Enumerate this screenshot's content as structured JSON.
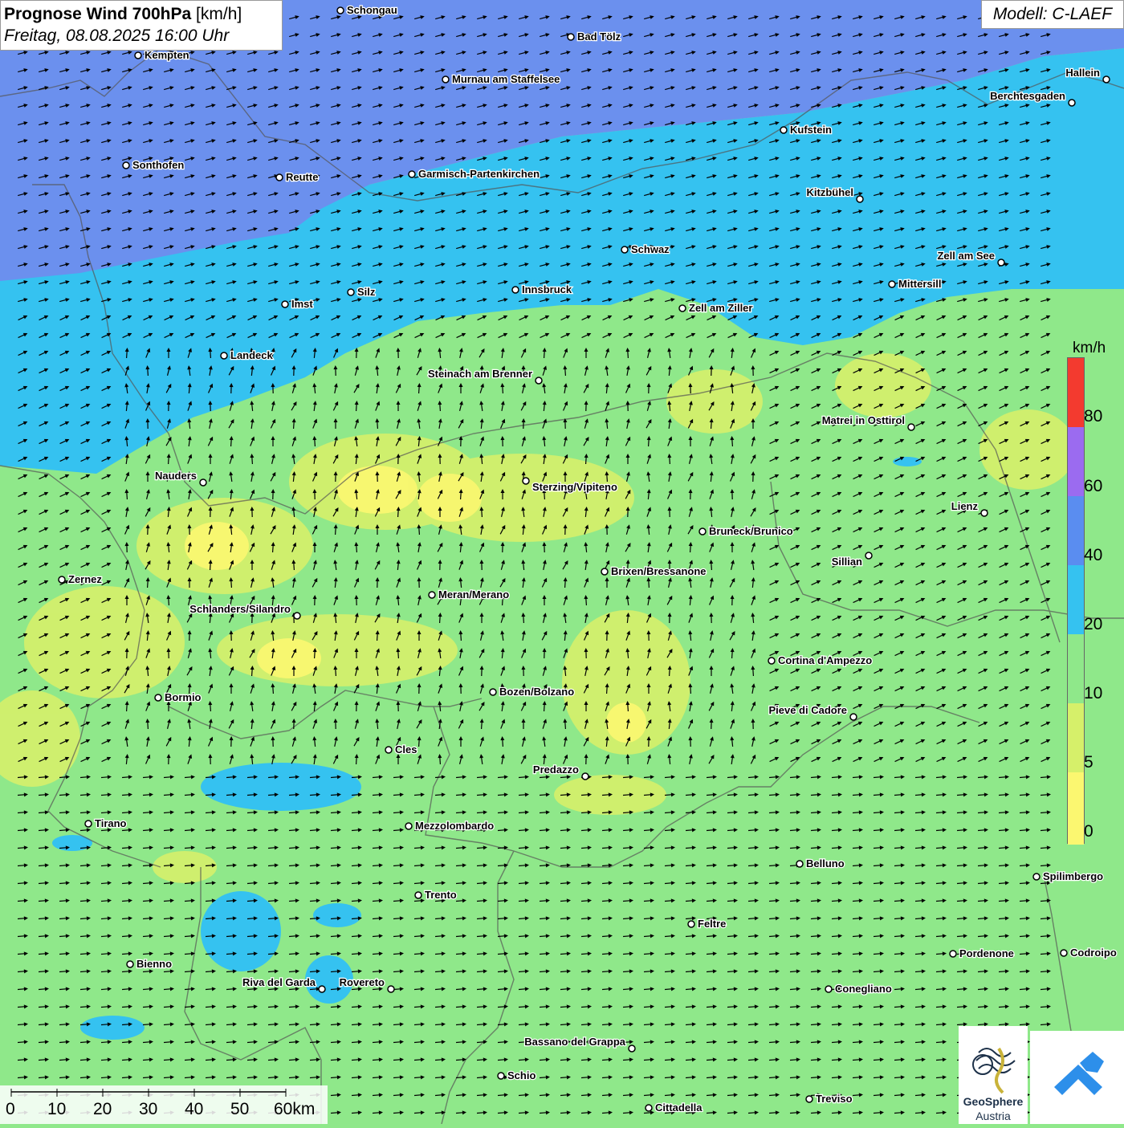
{
  "title": {
    "main": "Prognose Wind 700hPa",
    "unit": "[km/h]",
    "date": "Freitag, 08.08.2025 16:00 Uhr"
  },
  "model": "Modell: C-LAEF",
  "legend": {
    "unit": "km/h",
    "labels": [
      "80",
      "60",
      "40",
      "20",
      "10",
      "5",
      "0"
    ],
    "colors": [
      "#f33a2f",
      "#9b6bf0",
      "#5a8df0",
      "#35c2f0",
      "#8fe88a",
      "#d6f06a",
      "#fbf770"
    ]
  },
  "scalebar": {
    "labels": [
      "0",
      "10",
      "20",
      "30",
      "40",
      "50",
      "60km"
    ]
  },
  "logo": {
    "line1": "GeoSphere",
    "line2": "Austria"
  },
  "cities": [
    {
      "name": "Schongau",
      "anchor": "right"
    },
    {
      "name": "Bad Tölz",
      "anchor": "right"
    },
    {
      "name": "Kempten",
      "anchor": "right"
    },
    {
      "name": "Murnau am Staffelsee",
      "anchor": "right"
    },
    {
      "name": "Hallein",
      "anchor": "left"
    },
    {
      "name": "Berchtesgaden",
      "anchor": "left"
    },
    {
      "name": "Kufstein",
      "anchor": "right"
    },
    {
      "name": "Sonthofen",
      "anchor": "right"
    },
    {
      "name": "Reutte",
      "anchor": "right"
    },
    {
      "name": "Garmisch-Partenkirchen",
      "anchor": "right"
    },
    {
      "name": "Kitzbühel",
      "anchor": "left"
    },
    {
      "name": "Schwaz",
      "anchor": "right"
    },
    {
      "name": "Zell am See",
      "anchor": "left"
    },
    {
      "name": "Mittersill",
      "anchor": "right"
    },
    {
      "name": "Imst",
      "anchor": "right"
    },
    {
      "name": "Silz",
      "anchor": "right"
    },
    {
      "name": "Innsbruck",
      "anchor": "right"
    },
    {
      "name": "Zell am Ziller",
      "anchor": "right"
    },
    {
      "name": "Landeck",
      "anchor": "right"
    },
    {
      "name": "Steinach am Brenner",
      "anchor": "left"
    },
    {
      "name": "Matrei in Osttirol",
      "anchor": "left"
    },
    {
      "name": "Nauders",
      "anchor": "left"
    },
    {
      "name": "Sterzing/Vipiteno",
      "anchor": "rightbelow"
    },
    {
      "name": "Lienz",
      "anchor": "left"
    },
    {
      "name": "Bruneck/Brunico",
      "anchor": "right"
    },
    {
      "name": "Sillian",
      "anchor": "leftbelow"
    },
    {
      "name": "Zernez",
      "anchor": "right"
    },
    {
      "name": "Brixen/Bressanone",
      "anchor": "right"
    },
    {
      "name": "Meran/Merano",
      "anchor": "right"
    },
    {
      "name": "Schlanders/Silandro",
      "anchor": "leftabove"
    },
    {
      "name": "Cortina d'Ampezzo",
      "anchor": "right"
    },
    {
      "name": "Bozen/Bolzano",
      "anchor": "right"
    },
    {
      "name": "Bormio",
      "anchor": "right"
    },
    {
      "name": "Pieve di Cadore",
      "anchor": "leftabove"
    },
    {
      "name": "Cles",
      "anchor": "right"
    },
    {
      "name": "Predazzo",
      "anchor": "leftabove"
    },
    {
      "name": "Tirano",
      "anchor": "right"
    },
    {
      "name": "Mezzolombardo",
      "anchor": "right"
    },
    {
      "name": "Belluno",
      "anchor": "right"
    },
    {
      "name": "Spilimbergo",
      "anchor": "right"
    },
    {
      "name": "Trento",
      "anchor": "right"
    },
    {
      "name": "Feltre",
      "anchor": "right"
    },
    {
      "name": "Pordenone",
      "anchor": "right"
    },
    {
      "name": "Codroipo",
      "anchor": "right"
    },
    {
      "name": "Bienno",
      "anchor": "right"
    },
    {
      "name": "Riva del Garda",
      "anchor": "leftabove"
    },
    {
      "name": "Rovereto",
      "anchor": "leftabove"
    },
    {
      "name": "Conegliano",
      "anchor": "right"
    },
    {
      "name": "Bassano del Grappa",
      "anchor": "leftabove"
    },
    {
      "name": "Schio",
      "anchor": "right"
    },
    {
      "name": "Treviso",
      "anchor": "right"
    },
    {
      "name": "Cittadella",
      "anchor": "right"
    }
  ]
}
